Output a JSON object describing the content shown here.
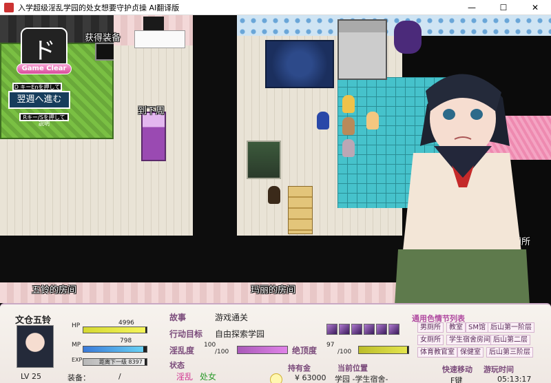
{
  "window": {
    "title": "入学超级淫乱学园的处女想要守护贞操 AI翻译版",
    "minimize": "—",
    "maximize": "☐",
    "close": "✕"
  },
  "map": {
    "logo_glyph": "ド",
    "logo_banner": "Game Clear",
    "label_equip": "获得装备",
    "label_next_week": "到下周",
    "sign_top": "D キーEnを押しても移動",
    "sign_main": "翌週へ進む",
    "sign_bottom": "Rキー/Sを押して説明",
    "room_left": "五铃的房间",
    "room_right": "玛丽的房间",
    "room_toilet": "厕所"
  },
  "hud": {
    "name": "文仓五铃",
    "hp_label": "HP",
    "hp_value": "4996",
    "hp_fill": 0.98,
    "mp_label": "MP",
    "mp_value": "798",
    "mp_fill": 0.95,
    "exp_label": "EXP",
    "exp_text": "距离下一级 8397",
    "exp_fill": 0.97,
    "level": "LV  25",
    "equip_label": "装备：",
    "equip_value": "/",
    "story_label": "故事",
    "story_value": "游戏通关",
    "goal_label": "行动目标",
    "goal_value": "自由探索学园",
    "lewd_label": "淫乱度",
    "lewd_value": "100",
    "lewd_max": "/100",
    "lewd_fill": 1.0,
    "climax_label": "绝顶度",
    "climax_value": "97",
    "climax_max": "/100",
    "climax_fill": 0.97,
    "status_label": "状态",
    "status_1": "淫乱",
    "status_2": "处女",
    "money_label": "持有金",
    "money_value": "¥ 63000",
    "location_label": "当前位置",
    "location_value": "学园 -学生宿舍-",
    "event_title": "通用色情节列表",
    "events": [
      "男厕所",
      "教室",
      "SM馆",
      "后山第一阶层",
      "女厕所",
      "学生宿舍房间",
      "后山第二层",
      "体育教官室",
      "保健室",
      "后山第三阶层"
    ],
    "fast_travel": "快速移动",
    "fast_travel_key": "F键",
    "play_time_label": "游玩时间",
    "play_time": "05:13:17"
  }
}
